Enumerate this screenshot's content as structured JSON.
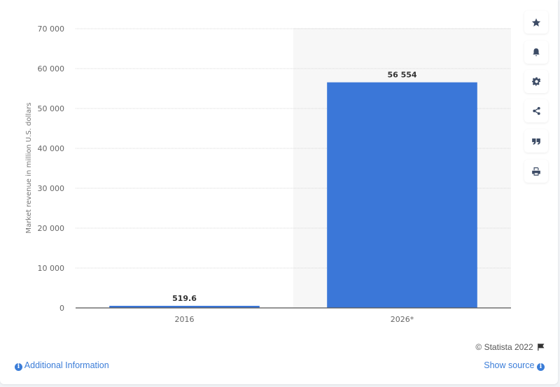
{
  "chart_data": {
    "type": "bar",
    "title": "",
    "xlabel": "",
    "ylabel": "Market revenue in million U.S. dollars",
    "categories": [
      "2016",
      "2026*"
    ],
    "values": [
      519.6,
      56554
    ],
    "value_labels": [
      "519.6",
      "56 554"
    ],
    "ylim": [
      0,
      70000
    ],
    "yticks": [
      0,
      10000,
      20000,
      30000,
      40000,
      50000,
      60000,
      70000
    ],
    "ytick_labels": [
      "0",
      "10 000",
      "20 000",
      "30 000",
      "40 000",
      "50 000",
      "60 000",
      "70 000"
    ],
    "grid": true,
    "highlighted_category": "2026*",
    "bar_color": "#3b77d8"
  },
  "sidebar": {
    "buttons": [
      {
        "name": "favorite",
        "icon": "star-icon"
      },
      {
        "name": "notification",
        "icon": "bell-icon"
      },
      {
        "name": "settings",
        "icon": "gear-icon"
      },
      {
        "name": "share",
        "icon": "share-icon"
      },
      {
        "name": "cite",
        "icon": "quote-icon"
      },
      {
        "name": "print",
        "icon": "print-icon"
      }
    ]
  },
  "footer": {
    "copyright": "© Statista 2022",
    "additional_info": "Additional Information",
    "show_source": "Show source"
  },
  "colors": {
    "accent": "#3b7dd8",
    "bar": "#3b77d8",
    "icon": "#3d4c66"
  }
}
